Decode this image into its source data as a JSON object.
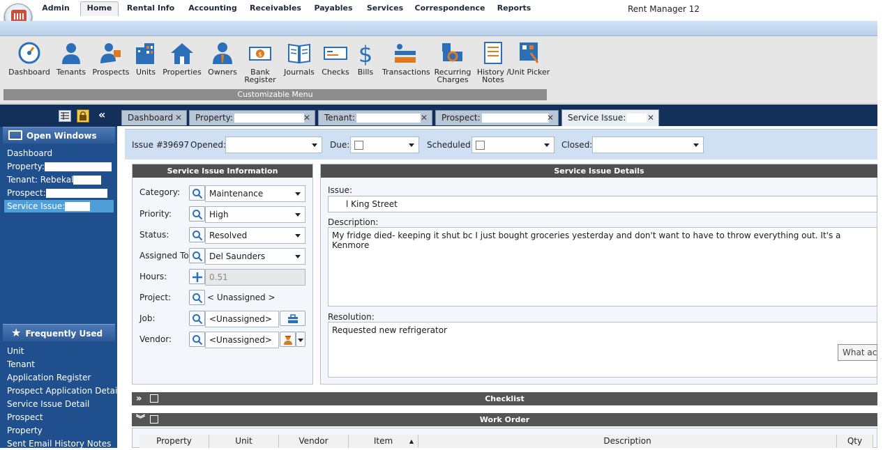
{
  "app": {
    "title": "Rent Manager 12"
  },
  "menu": {
    "tabs": [
      "Admin",
      "Home",
      "Rental Info",
      "Accounting",
      "Receivables",
      "Payables",
      "Services",
      "Correspondence",
      "Reports"
    ],
    "active": "Home"
  },
  "ribbon": {
    "items": [
      {
        "label": "Dashboard",
        "icon": "gauge-icon"
      },
      {
        "label": "Tenants",
        "icon": "person-icon"
      },
      {
        "label": "Prospects",
        "icon": "prospect-icon"
      },
      {
        "label": "Units",
        "icon": "building-icon"
      },
      {
        "label": "Properties",
        "icon": "house-icon"
      },
      {
        "label": "Owners",
        "icon": "owner-icon"
      },
      {
        "label": "Bank Register",
        "icon": "bank-icon"
      },
      {
        "label": "Journals",
        "icon": "book-icon"
      },
      {
        "label": "Checks",
        "icon": "check-icon"
      },
      {
        "label": "Bills",
        "icon": "dollar-icon"
      },
      {
        "label": "Transactions",
        "icon": "transactions-icon"
      },
      {
        "label": "Recurring Charges",
        "icon": "recurring-icon"
      },
      {
        "label": "History / Notes",
        "icon": "notes-icon"
      },
      {
        "label": "Unit Picker",
        "icon": "unit-picker-icon"
      }
    ],
    "group_label": "Customizable Menu"
  },
  "sidebar": {
    "open_windows_title": "Open Windows",
    "open_windows": [
      "Dashboard",
      "Property:",
      "Tenant: Rebekal",
      "Prospect:",
      "Service Issue:"
    ],
    "frequently_used_title": "Frequently Used",
    "frequently_used": [
      "Unit",
      "Tenant",
      "Application Register",
      "Prospect Application Detail",
      "Service Issue Detail",
      "Prospect",
      "Property",
      "Sent Email History Notes"
    ]
  },
  "tabs": [
    "Dashboard",
    "Property:",
    "Tenant:",
    "Prospect:",
    "Service Issue:"
  ],
  "issue": {
    "number_label": "Issue #:",
    "number": "39697",
    "opened_label": "Opened:",
    "due_label": "Due:",
    "scheduled_label": "Scheduled:",
    "closed_label": "Closed:"
  },
  "info_panel": {
    "title": "Service Issue Information",
    "category_label": "Category:",
    "category": "Maintenance",
    "priority_label": "Priority:",
    "priority": "High",
    "status_label": "Status:",
    "status": "Resolved",
    "assigned_label": "Assigned To:",
    "assigned": "Del Saunders",
    "hours_label": "Hours:",
    "hours": "0.51",
    "project_label": "Project:",
    "project": "< Unassigned >",
    "job_label": "Job:",
    "job": "<Unassigned>",
    "vendor_label": "Vendor:",
    "vendor": "<Unassigned>"
  },
  "details_panel": {
    "title": "Service Issue Details",
    "issue_label": "Issue:",
    "issue_value": "l King Street",
    "description_label": "Description:",
    "description": "My fridge died- keeping it shut bc I just bought groceries yesterday and don't want to have to throw everything out. It's a Kenmore",
    "resolution_label": "Resolution:",
    "resolution": "Requested new refrigerator",
    "hint_button": "What acti"
  },
  "sections": {
    "checklist": "Checklist",
    "work_order": "Work Order"
  },
  "work_order_columns": [
    "Property",
    "Unit",
    "Vendor",
    "Item",
    "Description",
    "Qty"
  ]
}
